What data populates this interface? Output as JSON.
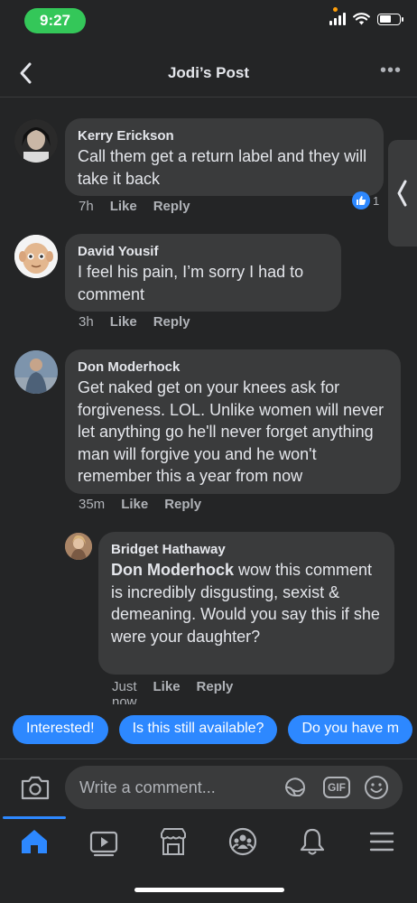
{
  "status_bar": {
    "time": "9:27",
    "battery_level": 0.6
  },
  "header": {
    "title": "Jodi’s Post"
  },
  "comments": [
    {
      "author": "Kerry Erickson",
      "text": "Call them get a return label and they will take it back",
      "time": "7h",
      "like_label": "Like",
      "reply_label": "Reply",
      "reaction_count": "1"
    },
    {
      "author": "David Yousif",
      "text": "I feel his pain, I’m sorry I had to comment",
      "time": "3h",
      "like_label": "Like",
      "reply_label": "Reply"
    },
    {
      "author": "Don Moderhock",
      "text": "Get naked get on your knees ask for forgiveness. LOL. Unlike women will never let anything go he'll never forget anything man will forgive you and he won't remember this a year from now",
      "time": "35m",
      "like_label": "Like",
      "reply_label": "Reply"
    },
    {
      "author": "Bridget Hathaway",
      "mention": "Don Moderhock",
      "text": " wow this comment is incredibly disgusting, sexist & demeaning. Would you say this if she were your daughter?",
      "time": "Just now",
      "like_label": "Like",
      "reply_label": "Reply"
    }
  ],
  "quick_replies": [
    "Interested!",
    "Is this still available?",
    "Do you have m"
  ],
  "composer": {
    "placeholder": "Write a comment...",
    "gif_label": "GIF"
  },
  "tabs": [
    {
      "icon": "home-icon",
      "active": true
    },
    {
      "icon": "watch-icon"
    },
    {
      "icon": "marketplace-icon"
    },
    {
      "icon": "groups-icon"
    },
    {
      "icon": "notifications-icon"
    },
    {
      "icon": "menu-icon"
    }
  ],
  "colors": {
    "background": "#242526",
    "bubble": "#3a3b3c",
    "accent": "#2d88ff",
    "muted": "#b0b3b8"
  }
}
